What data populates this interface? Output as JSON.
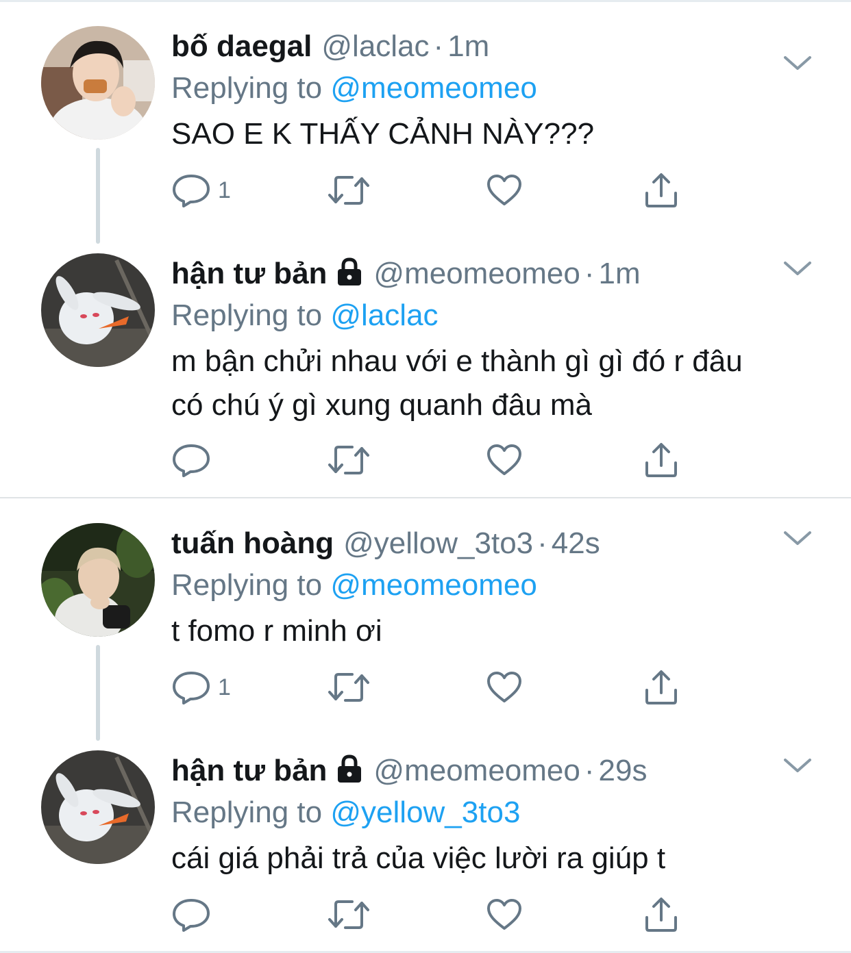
{
  "tweets": [
    {
      "name": "bố daegal",
      "handle": "@laclac",
      "time": "1m",
      "locked": false,
      "reply_prefix": "Replying to",
      "reply_to": "@meomeomeo",
      "text_lines": [
        "SAO E K THẤY CẢNH NÀY???"
      ],
      "reply_count": "1",
      "avatar": "avatar-person-eating"
    },
    {
      "name": "hận tư bản",
      "handle": "@meomeomeo",
      "time": "1m",
      "locked": true,
      "reply_prefix": "Replying to",
      "reply_to": "@laclac",
      "text_lines": [
        "m bận chửi nhau với e thành gì gì đó r đâu",
        "có chú ý gì xung quanh đâu mà"
      ],
      "reply_count": "",
      "avatar": "avatar-white-rabbit"
    },
    {
      "name": "tuấn hoàng",
      "handle": "@yellow_3to3",
      "time": "42s",
      "locked": false,
      "reply_prefix": "Replying to",
      "reply_to": "@meomeomeo",
      "text_lines": [
        "t fomo r minh ơi"
      ],
      "reply_count": "1",
      "avatar": "avatar-person-outdoors"
    },
    {
      "name": "hận tư bản",
      "handle": "@meomeomeo",
      "time": "29s",
      "locked": true,
      "reply_prefix": "Replying to",
      "reply_to": "@yellow_3to3",
      "text_lines": [
        "cái giá phải trả của việc lười ra giúp t"
      ],
      "reply_count": "",
      "avatar": "avatar-white-rabbit"
    }
  ],
  "icons": {
    "reply": "reply-icon",
    "retweet": "retweet-icon",
    "like": "heart-icon",
    "share": "share-icon",
    "menu": "chevron-down-icon",
    "lock": "lock-icon"
  },
  "colors": {
    "link": "#1da1f2",
    "secondary": "#657786",
    "text": "#14171a",
    "thread_line": "#cfd9de"
  }
}
